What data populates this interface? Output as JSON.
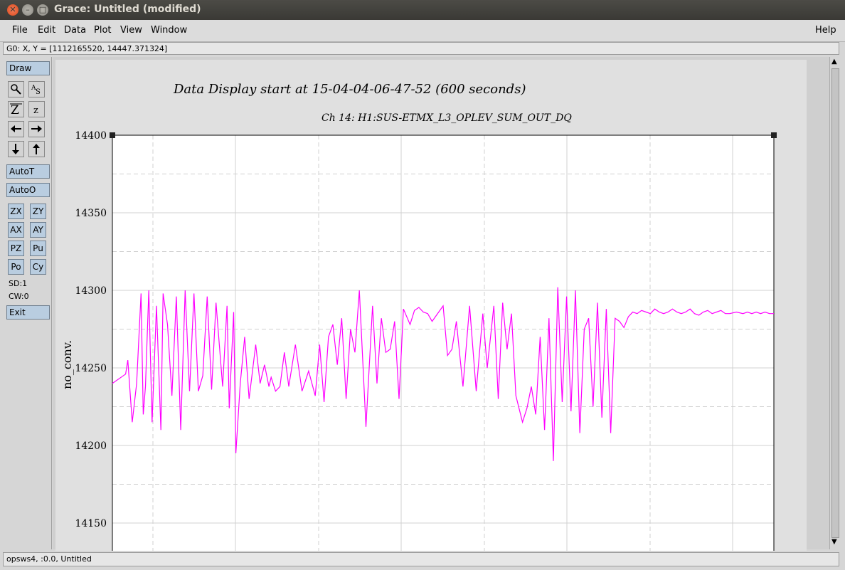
{
  "window": {
    "title": "Grace: Untitled (modified)"
  },
  "menu": [
    "File",
    "Edit",
    "Data",
    "Plot",
    "View",
    "Window"
  ],
  "help": "Help",
  "locator": "G0: X, Y = [1112165520, 14447.371324]",
  "toolbar": {
    "draw": "Draw",
    "autot": "AutoT",
    "autoo": "AutoO",
    "zx": "ZX",
    "zy": "ZY",
    "ax": "AX",
    "ay": "AY",
    "pz": "PZ",
    "pu": "Pu",
    "po": "Po",
    "cy": "Cy",
    "sd": "SD:1",
    "cw": "CW:0",
    "exit": "Exit"
  },
  "status": "opsws4, :0.0, Untitled",
  "colors": {
    "series": "#ff00ff",
    "grid": "#d0d0d0"
  },
  "chart_data": {
    "type": "line",
    "title": "Data Display start at 15-04-04-06-47-52 (600 seconds)",
    "subtitle": "Ch 14: H1:SUS-ETMX_L3_OPLEV_SUM_OUT_DQ",
    "ylabel": "no_conv.",
    "xlabel": "",
    "ylim": [
      14130,
      14400
    ],
    "yticks": [
      14150,
      14200,
      14250,
      14300,
      14350,
      14400
    ],
    "xlim": [
      0,
      600
    ],
    "grid": true,
    "series": [
      {
        "name": "",
        "x": [
          0,
          12,
          14,
          18,
          22,
          26,
          28,
          30,
          33,
          36,
          40,
          44,
          46,
          50,
          54,
          58,
          62,
          66,
          70,
          74,
          78,
          82,
          86,
          90,
          94,
          100,
          104,
          106,
          110,
          112,
          116,
          120,
          124,
          130,
          134,
          138,
          142,
          144,
          148,
          152,
          156,
          160,
          166,
          172,
          178,
          184,
          188,
          192,
          196,
          200,
          204,
          208,
          212,
          216,
          220,
          224,
          230,
          236,
          240,
          244,
          248,
          252,
          256,
          260,
          264,
          270,
          274,
          278,
          282,
          286,
          290,
          296,
          300,
          304,
          308,
          312,
          318,
          324,
          330,
          336,
          340,
          346,
          350,
          354,
          358,
          362,
          366,
          372,
          376,
          380,
          384,
          388,
          392,
          396,
          400,
          404,
          408,
          412,
          416,
          420,
          424,
          428,
          432,
          436,
          440,
          444,
          448,
          452,
          456,
          460,
          464,
          468,
          472,
          476,
          480,
          484,
          488,
          492,
          496,
          500,
          504,
          508,
          512,
          516,
          520,
          524,
          528,
          532,
          536,
          540,
          544,
          548,
          552,
          556,
          560,
          566,
          572,
          576,
          580,
          584,
          588,
          592,
          596,
          600
        ],
        "y": [
          14240,
          14246,
          14255,
          14215,
          14240,
          14298,
          14220,
          14238,
          14300,
          14215,
          14290,
          14210,
          14298,
          14278,
          14232,
          14296,
          14210,
          14300,
          14235,
          14298,
          14235,
          14245,
          14296,
          14236,
          14292,
          14238,
          14290,
          14224,
          14286,
          14195,
          14240,
          14270,
          14230,
          14265,
          14240,
          14252,
          14238,
          14244,
          14235,
          14238,
          14260,
          14238,
          14265,
          14235,
          14248,
          14232,
          14265,
          14228,
          14270,
          14278,
          14252,
          14282,
          14230,
          14275,
          14260,
          14300,
          14212,
          14290,
          14240,
          14282,
          14260,
          14262,
          14280,
          14230,
          14288,
          14278,
          14287,
          14289,
          14286,
          14285,
          14280,
          14286,
          14290,
          14258,
          14262,
          14280,
          14238,
          14290,
          14235,
          14285,
          14250,
          14290,
          14230,
          14292,
          14262,
          14285,
          14232,
          14215,
          14224,
          14238,
          14220,
          14270,
          14210,
          14282,
          14190,
          14302,
          14228,
          14296,
          14222,
          14300,
          14208,
          14275,
          14282,
          14225,
          14292,
          14218,
          14288,
          14208,
          14282,
          14280,
          14276,
          14283,
          14286,
          14285,
          14287,
          14286,
          14285,
          14288,
          14286,
          14285,
          14286,
          14288,
          14286,
          14285,
          14286,
          14288,
          14285,
          14284,
          14286,
          14287,
          14285,
          14286,
          14287,
          14285,
          14285,
          14286,
          14285,
          14286,
          14285,
          14286,
          14285,
          14286,
          14285,
          14285
        ]
      }
    ]
  }
}
